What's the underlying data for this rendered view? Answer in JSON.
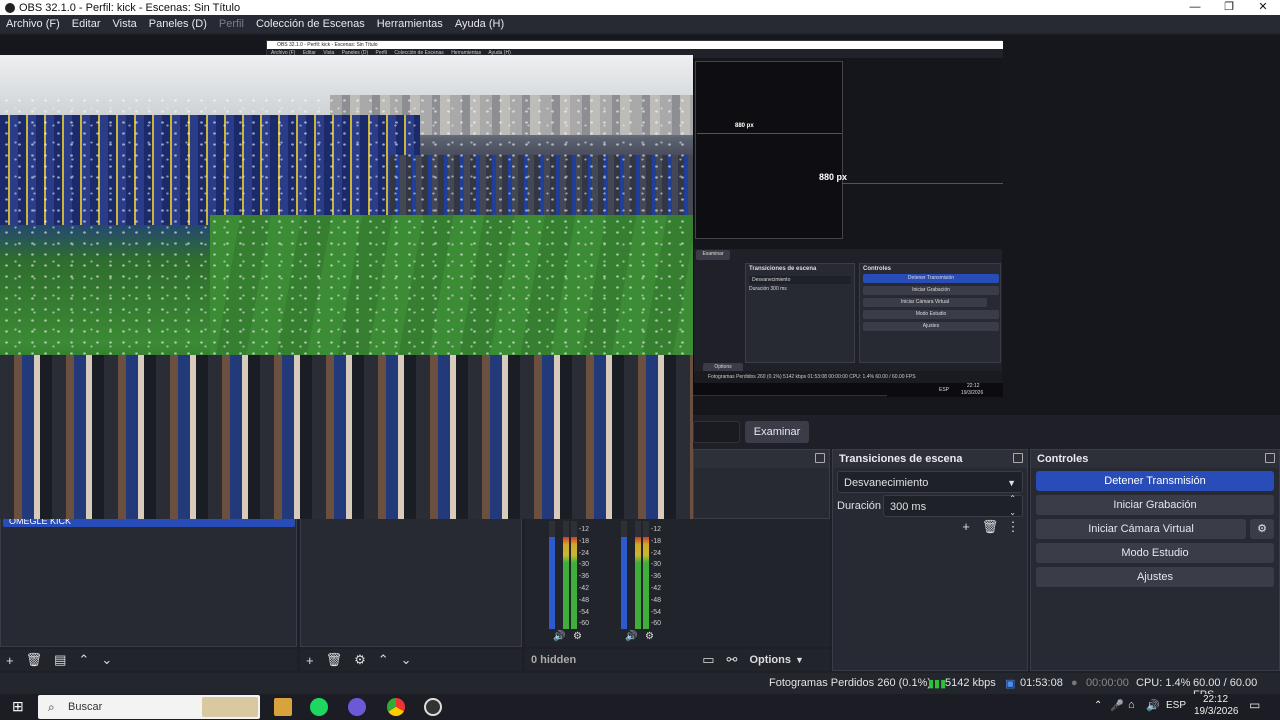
{
  "window": {
    "title": "OBS 32.1.0 - Perfil: kick - Escenas: Sin Título",
    "min": "—",
    "max": "❐",
    "close": "✕"
  },
  "menu": {
    "items": [
      "Archivo (F)",
      "Editar",
      "Vista",
      "Paneles (D)",
      "Perfil",
      "Colección de Escenas",
      "Herramientas",
      "Ayuda (H)"
    ]
  },
  "nested": {
    "title": "OBS 32.1.0 - Perfil: kick - Escenas: Sin Título",
    "menu": [
      "Archivo (F)",
      "Editar",
      "Vista",
      "Paneles (D)",
      "Perfil",
      "Colección de Escenas",
      "Herramientas",
      "Ayuda (H)"
    ],
    "px1": "880 px",
    "px2": "880 px",
    "examinar": "Examinar",
    "trans_title": "Transiciones de escena",
    "trans_select": "Desvanecimiento",
    "dur_label": "Duración",
    "dur_value": "300 ms",
    "ctrl_title": "Controles",
    "buttons": [
      "Detener Transmisión",
      "Iniciar Grabación",
      "Iniciar Cámara Virtual",
      "Modo Estudio",
      "Ajustes"
    ],
    "options": "Options",
    "status": "Fotogramas Perdidos 260 (0.1%)   5142 kbps   01:53:08   00:00:00   CPU: 1.4%   60.00 / 60.00 FPS",
    "time": "22:12",
    "date": "19/3/2026",
    "lang": "ESP"
  },
  "source_browse": "Examinar",
  "scene_selected": "OMEGLE KICK",
  "transitions": {
    "title": "Transiciones de escena",
    "select": "Desvanecimiento",
    "duration_label": "Duración",
    "duration_value": "300 ms"
  },
  "controls": {
    "title": "Controles",
    "stream": "Detener Transmisión",
    "record": "Iniciar Grabación",
    "virtualcam": "Iniciar Cámara Virtual",
    "studio": "Modo Estudio",
    "settings": "Ajustes"
  },
  "mixer": {
    "hidden": "0 hidden",
    "options": "Options",
    "scale": [
      "-12",
      "-18",
      "-24",
      "-30",
      "-36",
      "-42",
      "-48",
      "-54",
      "-60"
    ],
    "level1": 0.85,
    "level2": 0.85
  },
  "status": {
    "dropped": "Fotogramas Perdidos 260 (0.1%)",
    "bitrate": "5142 kbps",
    "stream_time": "01:53:08",
    "rec_time": "00:00:00",
    "cpu": "CPU: 1.4%",
    "fps": "60.00 / 60.00 FPS"
  },
  "taskbar": {
    "search": "Buscar",
    "lang": "ESP",
    "time": "22:12",
    "date": "19/3/2026"
  },
  "colors": {
    "accent": "#284cb8",
    "panel": "#272a33",
    "bg": "#1e1f27"
  }
}
